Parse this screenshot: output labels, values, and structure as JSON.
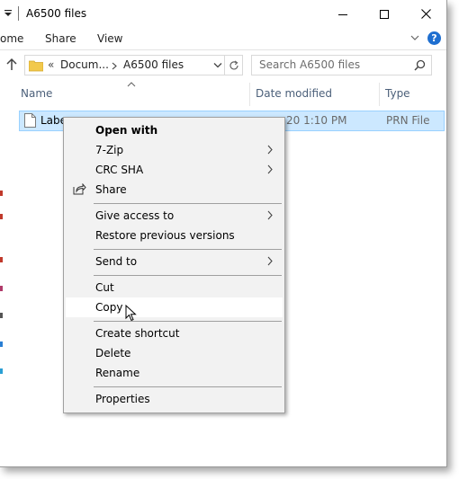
{
  "window": {
    "title": "A6500 files"
  },
  "ribbon": {
    "tabs": [
      "ome",
      "Share",
      "View"
    ]
  },
  "address": {
    "prefix": "«",
    "crumbs": [
      "Docum...",
      "A6500 files"
    ],
    "search_placeholder": "Search A6500 files"
  },
  "columns": {
    "name": "Name",
    "date": "Date modified",
    "type": "Type"
  },
  "file": {
    "name": "Labe",
    "date": "20 1:10 PM",
    "type": "PRN File"
  },
  "context_menu": {
    "items": [
      {
        "label": "Open with"
      },
      {
        "label": "7-Zip"
      },
      {
        "label": "CRC SHA"
      },
      {
        "label": "Share"
      },
      {
        "label": "Give access to"
      },
      {
        "label": "Restore previous versions"
      },
      {
        "label": "Send to"
      },
      {
        "label": "Cut"
      },
      {
        "label": "Copy"
      },
      {
        "label": "Create shortcut"
      },
      {
        "label": "Delete"
      },
      {
        "label": "Rename"
      },
      {
        "label": "Properties"
      }
    ]
  },
  "colors": {
    "selection_bg": "#cce8ff",
    "selection_border": "#99d1ff",
    "help_blue": "#1f6fd0",
    "menu_bg": "#f2f2f2"
  }
}
